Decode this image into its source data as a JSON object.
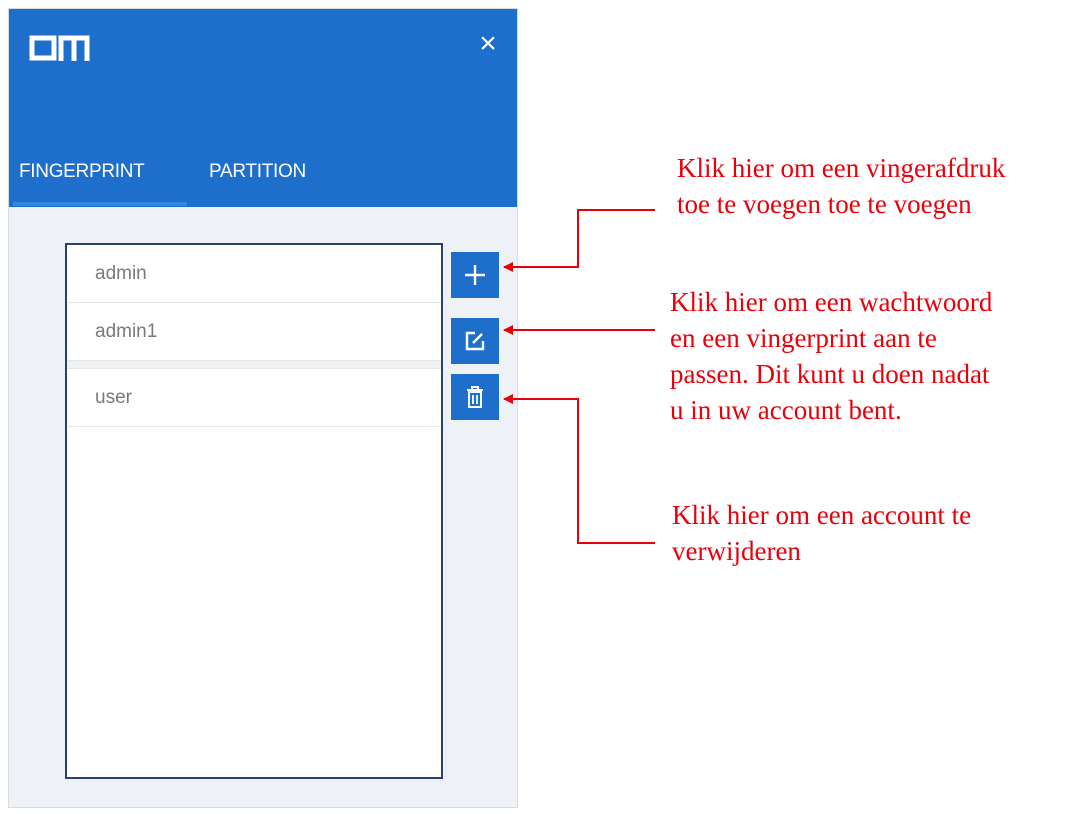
{
  "app": {
    "logo_text": "OM",
    "close_label": "×"
  },
  "tabs": [
    {
      "label": "FINGERPRINT",
      "active": true
    },
    {
      "label": "PARTITION",
      "active": false
    }
  ],
  "accounts": [
    "admin",
    "admin1",
    "user"
  ],
  "actions": {
    "add_icon": "plus-icon",
    "edit_icon": "edit-icon",
    "delete_icon": "trash-icon"
  },
  "annotations": {
    "add": [
      "Klik hier om een vingerafdruk",
      "toe te voegen  toe te voegen"
    ],
    "edit": [
      "Klik hier om een wachtwoord",
      "en een vingerprint aan te",
      "passen. Dit kunt u doen nadat",
      "u in uw account bent."
    ],
    "delete": [
      "Klik hier om een account te",
      "verwijderen"
    ]
  },
  "colors": {
    "accent": "#1e6fcc",
    "annotation": "#e8000b",
    "list_border": "#27456a"
  }
}
